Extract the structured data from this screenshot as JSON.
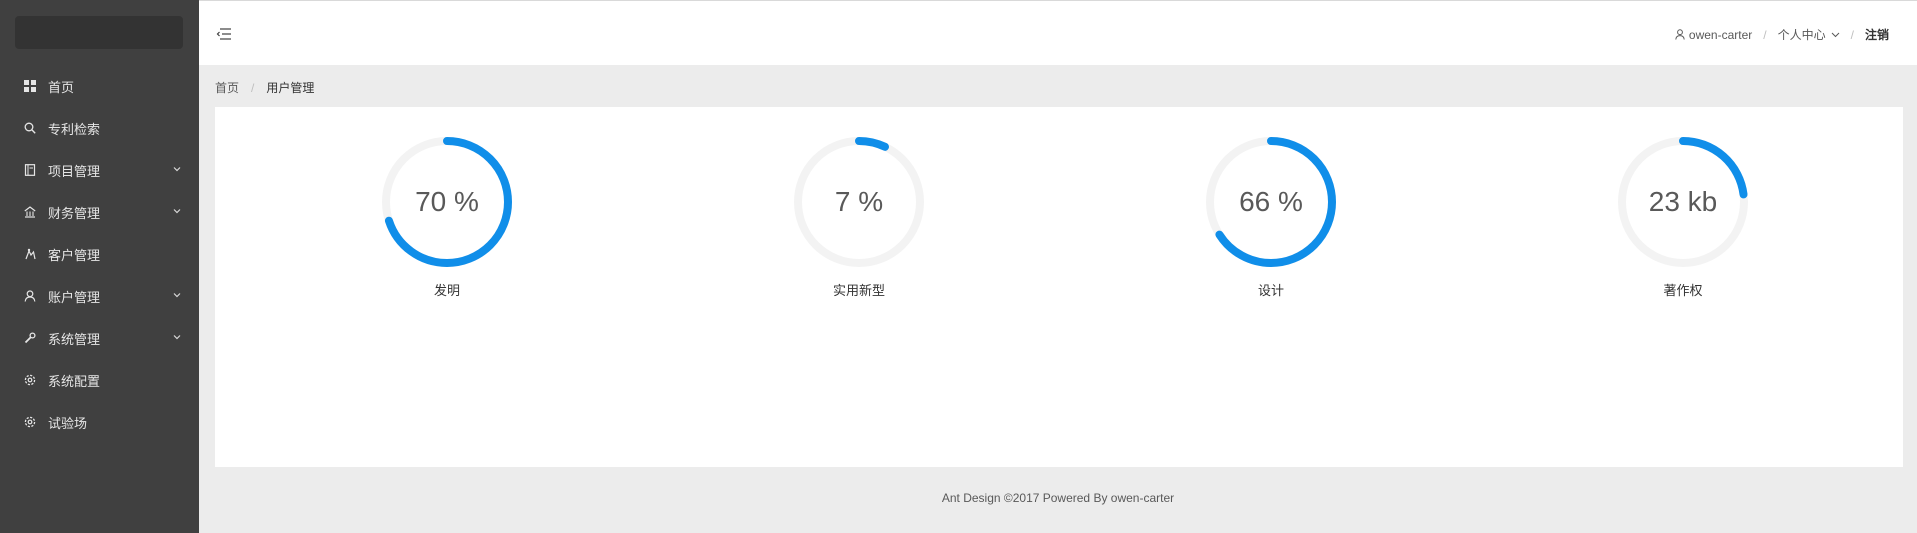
{
  "sidebar": {
    "items": [
      {
        "label": "首页",
        "icon": "dashboard-icon"
      },
      {
        "label": "专利检索",
        "icon": "search-icon"
      },
      {
        "label": "项目管理",
        "icon": "book-icon",
        "has_submenu": true
      },
      {
        "label": "财务管理",
        "icon": "bank-icon",
        "has_submenu": true
      },
      {
        "label": "客户管理",
        "icon": "customer-icon"
      },
      {
        "label": "账户管理",
        "icon": "user-icon",
        "has_submenu": true
      },
      {
        "label": "系统管理",
        "icon": "tool-icon",
        "has_submenu": true
      },
      {
        "label": "系统配置",
        "icon": "setting-icon"
      },
      {
        "label": "试验场",
        "icon": "setting-icon"
      }
    ]
  },
  "header": {
    "username": "owen-carter",
    "user_center": "个人中心",
    "logout": "注销",
    "separator": "/"
  },
  "breadcrumb": {
    "home": "首页",
    "separator": "/",
    "current": "用户管理"
  },
  "stats": [
    {
      "value_text": "70 %",
      "label": "发明",
      "percent": 70
    },
    {
      "value_text": "7 %",
      "label": "实用新型",
      "percent": 7
    },
    {
      "value_text": "66 %",
      "label": "设计",
      "percent": 66
    },
    {
      "value_text": "23 kb",
      "label": "著作权",
      "percent": 23
    }
  ],
  "colors": {
    "accent": "#108ee9",
    "ring_track": "#f3f3f3",
    "sidebar_bg": "#404040"
  },
  "footer": {
    "text": "Ant Design ©2017 Powered By owen-carter"
  }
}
